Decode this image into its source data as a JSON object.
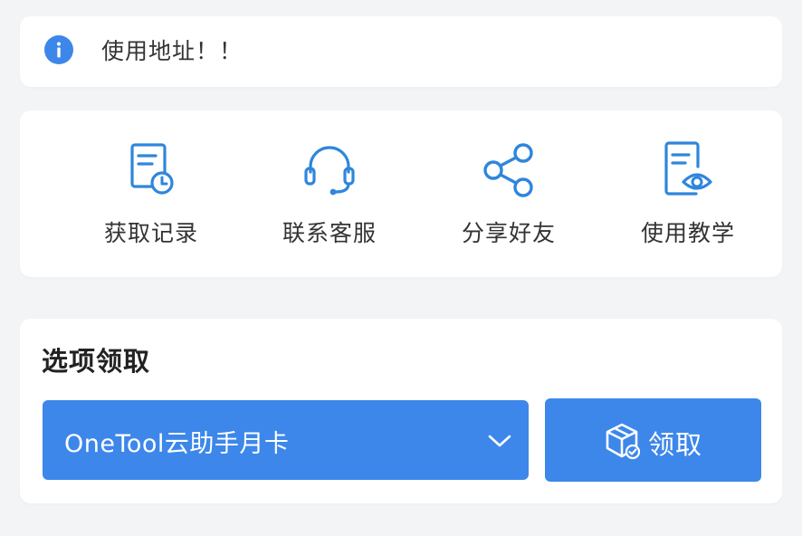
{
  "notice": {
    "text": "使用地址！！",
    "icon": "info-icon"
  },
  "colors": {
    "accent": "#3d87ea",
    "icon_blue": "#2f86dc",
    "text_dark": "#333333",
    "background": "#f3f4f6"
  },
  "actions": [
    {
      "label": "获取记录",
      "icon": "record-clock-icon"
    },
    {
      "label": "联系客服",
      "icon": "headset-icon"
    },
    {
      "label": "分享好友",
      "icon": "share-icon"
    },
    {
      "label": "使用教学",
      "icon": "document-eye-icon"
    }
  ],
  "claim": {
    "title": "选项领取",
    "selected_option": "OneTool云助手月卡",
    "button_label": "领取",
    "button_icon": "package-check-icon"
  }
}
